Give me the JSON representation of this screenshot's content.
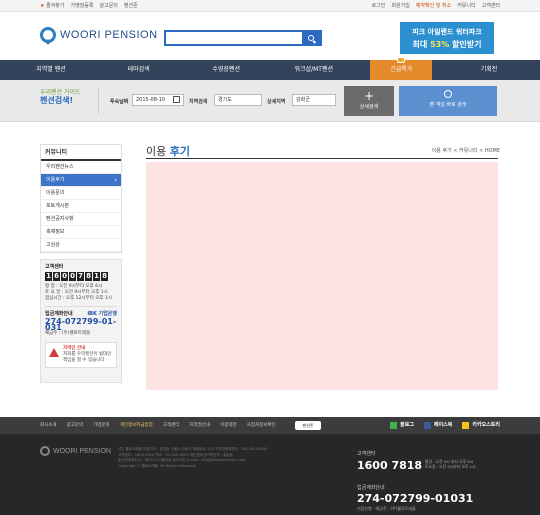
{
  "topbar": {
    "left": [
      "즐겨찾기",
      "가맹점등록",
      "광고문의",
      "펜션존"
    ],
    "right": [
      "로그인",
      "회원가입",
      "예약확인 및 취소",
      "커뮤니티",
      "고객센터"
    ],
    "highlight_index": 2
  },
  "header": {
    "logo": "WOORI PENSION",
    "search_placeholder": "",
    "banner": {
      "line1": "피크 아일랜드 워터파크",
      "line2_prefix": "최대 ",
      "line2_hl": "53%",
      "line2_suffix": " 할인받기"
    }
  },
  "nav": {
    "items": [
      "지역별 펜션",
      "테마검색",
      "수영장펜션",
      "워크샵/MT펜션",
      "긴급특가",
      "기획전"
    ],
    "active_index": 4
  },
  "filter": {
    "brand_small": "우리펜션 가이드",
    "brand_big": "펜션검색!",
    "date_label": "투숙날짜",
    "date_value": "2015-08-10",
    "region_label": "지역검색",
    "region_value": "경기도",
    "detail_label": "상세지역",
    "detail_value": "강화군",
    "detail_btn": "상세검색",
    "search_btn": "펜 객실 바로 검색"
  },
  "sidebar": {
    "title": "커뮤니티",
    "items": [
      "우리펜션뉴스",
      "이용후기",
      "이용문의",
      "포토게시판",
      "펜션공지사항",
      "축제정보",
      "고심상"
    ],
    "active_index": 1
  },
  "cs": {
    "title": "고객센터",
    "phone_digits": [
      "1",
      "6",
      "0",
      "0",
      "7",
      "8",
      "1",
      "8"
    ],
    "hours": [
      "평    일 : 오전 9시부터 오후 6시",
      "토 요 일 : 오전 9시부터 오후 1시",
      "점심시간 : 오후 12시부터 오후 1시"
    ],
    "account_title": "입금계좌안내",
    "bank": "IBK 기업은행",
    "account_number": "274-072799-01-031",
    "owner": "예금주 : (주)웰로트레블"
  },
  "warning": {
    "title": "지역인 안내",
    "text": "저희를 우리펜션이 법대인 책임을 질 수 있습니다"
  },
  "content": {
    "title_prefix": "이용",
    "title_hl": "후기",
    "breadcrumb": "이용 후기 < 커뮤니티 < HOME"
  },
  "footer_nav": {
    "items": [
      "회사소개",
      "광고문의",
      "가맹문의",
      "개인정보취급방침",
      "고객센터",
      "지적권안내",
      "이용약관",
      "사업자정보확인"
    ],
    "highlight_index": 3,
    "pill": "펜션존",
    "social": [
      "블로그",
      "페이스북",
      "카카오스토리"
    ]
  },
  "footer": {
    "logo": "WOORI PENSION",
    "address_lines": [
      "(주) 웰로트레블  대표이사 : 홍길동  서울시 강남구 테헤란로 123  사업자등록번호 : 000-00-00000",
      "고객센터 : 1600-7818  팩스 : 02-000-0000  개인정보관리책임자 : 홍길동",
      "통신판매업신고 : 제2014-서울강남-0000호  E-mail : help@wooripension.com",
      "Copyright ⓒ 웰로트레블. All Rights Reserved."
    ],
    "cs_label": "고객센터",
    "cs_number": "1600 7818",
    "cs_hours": [
      "평일 : 오전 9시 부터 오후 6시",
      "토요일 : 오전 9시부터 오후 1시"
    ],
    "acct_label": "입금계좌안내",
    "acct_number": "274-072799-01031",
    "acct_owner": "기업은행 · 예금주 : (주)웰로트레블"
  },
  "colors": {
    "nav_bg": "#33435b",
    "accent_orange": "#e58a2b",
    "brand_blue": "#2b6cbf",
    "content_bg": "#fee3e3"
  }
}
